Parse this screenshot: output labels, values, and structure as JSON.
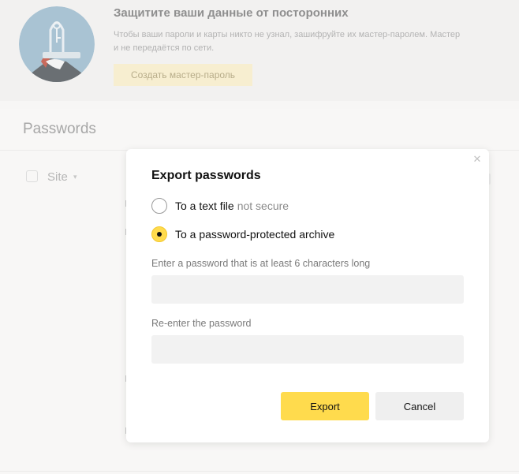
{
  "promo": {
    "title": "Защитите ваши данные от посторонних",
    "desc_line1": "Чтобы ваши пароли и карты никто не узнал, зашифруйте их мастер-паролем. Мастер",
    "desc_line2": "и не передаётся по сети.",
    "button": "Создать мастер-пароль"
  },
  "passwords": {
    "title": "Passwords",
    "column_site": "Site"
  },
  "dialog": {
    "title": "Export passwords",
    "close_icon": "close-icon",
    "options": [
      {
        "label": "To a text file",
        "note": "not secure",
        "checked": false
      },
      {
        "label": "To a password-protected archive",
        "note": "",
        "checked": true
      }
    ],
    "password_label": "Enter a password that is at least 6 characters long",
    "password_value": "",
    "confirm_label": "Re-enter the password",
    "confirm_value": "",
    "export_button": "Export",
    "cancel_button": "Cancel"
  },
  "colors": {
    "accent": "#ffdb4d",
    "field_bg": "#f2f2f2"
  }
}
